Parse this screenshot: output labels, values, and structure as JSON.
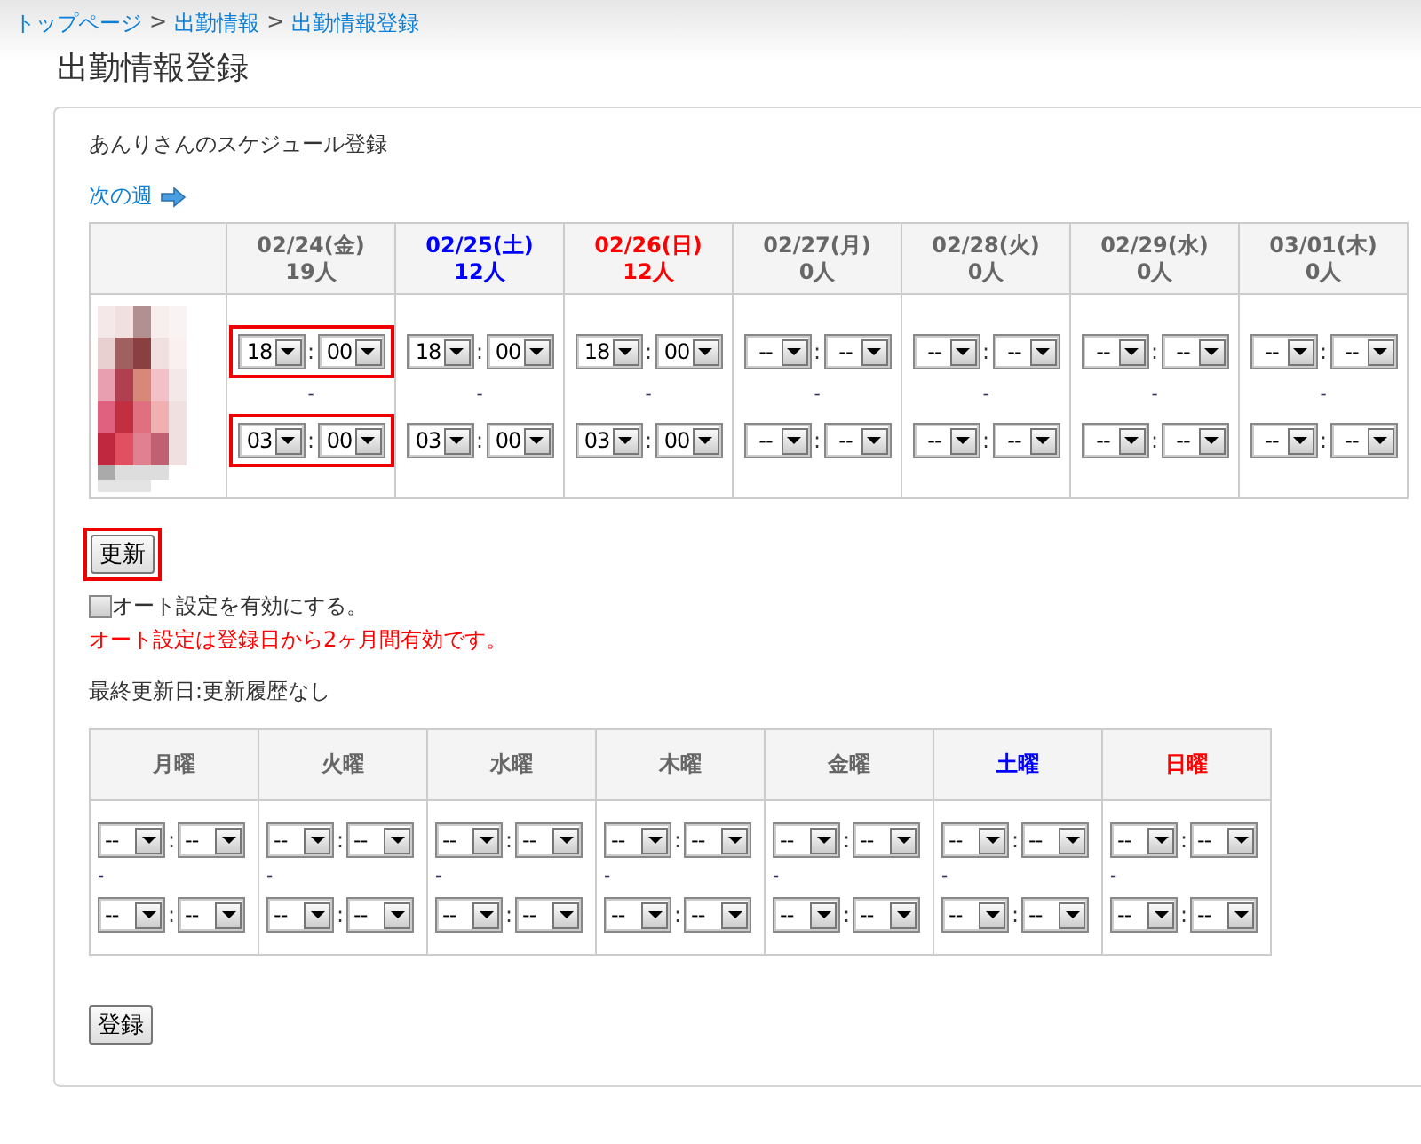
{
  "breadcrumb": [
    {
      "kind": "link",
      "label": "トップページ"
    },
    {
      "kind": "separator",
      "label": ">"
    },
    {
      "kind": "link",
      "label": "出勤情報"
    },
    {
      "kind": "separator",
      "label": ">"
    },
    {
      "kind": "link",
      "label": "出勤情報登録"
    }
  ],
  "title": "出勤情報登録",
  "panel": {
    "heading": "あんりさんのスケジュール登録",
    "next_week": "次の週",
    "days": [
      {
        "date": "02/24(金)",
        "count": "19人",
        "kind": "weekday",
        "highlighted": true,
        "start": {
          "hour": "18",
          "sep": ":",
          "minute": "00"
        },
        "dash": "-",
        "end": {
          "hour": "03",
          "sep": ":",
          "minute": "00"
        }
      },
      {
        "date": "02/25(土)",
        "count": "12人",
        "kind": "saturday",
        "highlighted": false,
        "start": {
          "hour": "18",
          "sep": ":",
          "minute": "00"
        },
        "dash": "-",
        "end": {
          "hour": "03",
          "sep": ":",
          "minute": "00"
        }
      },
      {
        "date": "02/26(日)",
        "count": "12人",
        "kind": "sunday",
        "highlighted": false,
        "start": {
          "hour": "18",
          "sep": ":",
          "minute": "00"
        },
        "dash": "-",
        "end": {
          "hour": "03",
          "sep": ":",
          "minute": "00"
        }
      },
      {
        "date": "02/27(月)",
        "count": "0人",
        "kind": "weekday",
        "highlighted": false,
        "start": {
          "hour": "--",
          "sep": ":",
          "minute": "--"
        },
        "dash": "-",
        "end": {
          "hour": "--",
          "sep": ":",
          "minute": "--"
        }
      },
      {
        "date": "02/28(火)",
        "count": "0人",
        "kind": "weekday",
        "highlighted": false,
        "start": {
          "hour": "--",
          "sep": ":",
          "minute": "--"
        },
        "dash": "-",
        "end": {
          "hour": "--",
          "sep": ":",
          "minute": "--"
        }
      },
      {
        "date": "02/29(水)",
        "count": "0人",
        "kind": "weekday",
        "highlighted": false,
        "start": {
          "hour": "--",
          "sep": ":",
          "minute": "--"
        },
        "dash": "-",
        "end": {
          "hour": "--",
          "sep": ":",
          "minute": "--"
        }
      },
      {
        "date": "03/01(木)",
        "count": "0人",
        "kind": "weekday",
        "highlighted": false,
        "start": {
          "hour": "--",
          "sep": ":",
          "minute": "--"
        },
        "dash": "-",
        "end": {
          "hour": "--",
          "sep": ":",
          "minute": "--"
        }
      }
    ],
    "update_button": {
      "label": "更新",
      "highlighted": true
    },
    "auto_setting": {
      "label": "オート設定を有効にする。",
      "checked": false
    },
    "notice": "オート設定は登録日から2ヶ月間有効です。",
    "last_updated": "最終更新日:更新履歴なし",
    "weekly": [
      {
        "label": "月曜",
        "kind": "weekday",
        "start": {
          "hour": "--",
          "sep": ":",
          "minute": "--"
        },
        "dash": "-",
        "end": {
          "hour": "--",
          "sep": ":",
          "minute": "--"
        }
      },
      {
        "label": "火曜",
        "kind": "weekday",
        "start": {
          "hour": "--",
          "sep": ":",
          "minute": "--"
        },
        "dash": "-",
        "end": {
          "hour": "--",
          "sep": ":",
          "minute": "--"
        }
      },
      {
        "label": "水曜",
        "kind": "weekday",
        "start": {
          "hour": "--",
          "sep": ":",
          "minute": "--"
        },
        "dash": "-",
        "end": {
          "hour": "--",
          "sep": ":",
          "minute": "--"
        }
      },
      {
        "label": "木曜",
        "kind": "weekday",
        "start": {
          "hour": "--",
          "sep": ":",
          "minute": "--"
        },
        "dash": "-",
        "end": {
          "hour": "--",
          "sep": ":",
          "minute": "--"
        }
      },
      {
        "label": "金曜",
        "kind": "weekday",
        "start": {
          "hour": "--",
          "sep": ":",
          "minute": "--"
        },
        "dash": "-",
        "end": {
          "hour": "--",
          "sep": ":",
          "minute": "--"
        }
      },
      {
        "label": "土曜",
        "kind": "saturday",
        "start": {
          "hour": "--",
          "sep": ":",
          "minute": "--"
        },
        "dash": "-",
        "end": {
          "hour": "--",
          "sep": ":",
          "minute": "--"
        }
      },
      {
        "label": "日曜",
        "kind": "sunday",
        "start": {
          "hour": "--",
          "sep": ":",
          "minute": "--"
        },
        "dash": "-",
        "end": {
          "hour": "--",
          "sep": ":",
          "minute": "--"
        }
      }
    ],
    "register_button": "登録"
  }
}
